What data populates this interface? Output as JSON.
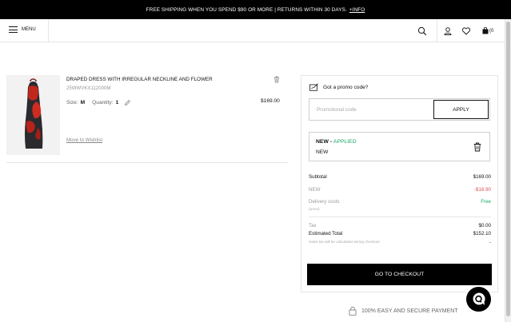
{
  "promo_bar": {
    "text": "FREE SHIPPING WHEN YOU SPEND $90 OR MORE  |  RETURNS WITHIN 30 DAYS.",
    "link": "+INFO"
  },
  "header": {
    "menu_label": "MENU",
    "cart_count": "(0"
  },
  "cart_item": {
    "name": "DRAPED DRESS WITH IRREGULAR NECKLINE AND FLOWER",
    "reference": "25WWVKX112000M",
    "size_label": "Size:",
    "size_value": "M",
    "quantity_label": "Quantity:",
    "quantity_value": "1",
    "price": "$169.00",
    "wishlist_label": "Move to Wishlist"
  },
  "summary": {
    "promo_title": "Got a promo code?",
    "promo_placeholder": "Promotional code",
    "apply_label": "APPLY",
    "applied_code": "NEW",
    "applied_separator": " - ",
    "applied_status": "APPLIED",
    "applied_description": "NEW",
    "subtotal_label": "Subtotal",
    "subtotal_value": "$169.00",
    "discount_label": "NEW",
    "discount_value": "-$16.90",
    "delivery_label": "Delivery costs",
    "delivery_sub": "(once)",
    "delivery_value": "Free",
    "tax_label": "Tax",
    "tax_value": "$0.00",
    "estimated_label": "Estimated Total",
    "estimated_value": "$152.10",
    "tax_note": "Sales tax will be calculated during checkout",
    "tax_note_value": "-",
    "checkout_label": "GO TO CHECKOUT",
    "secure_label": "100% EASY AND SECURE PAYMENT"
  },
  "colors": {
    "applied_green": "#1aa765",
    "discount_red": "#d9534f",
    "free_green": "#1aa765",
    "black": "#000000"
  },
  "icons": [
    "menu-icon",
    "search-icon",
    "user-icon",
    "heart-icon",
    "bag-icon",
    "trash-icon",
    "edit-icon",
    "promo-icon",
    "lock-icon",
    "chat-icon"
  ]
}
